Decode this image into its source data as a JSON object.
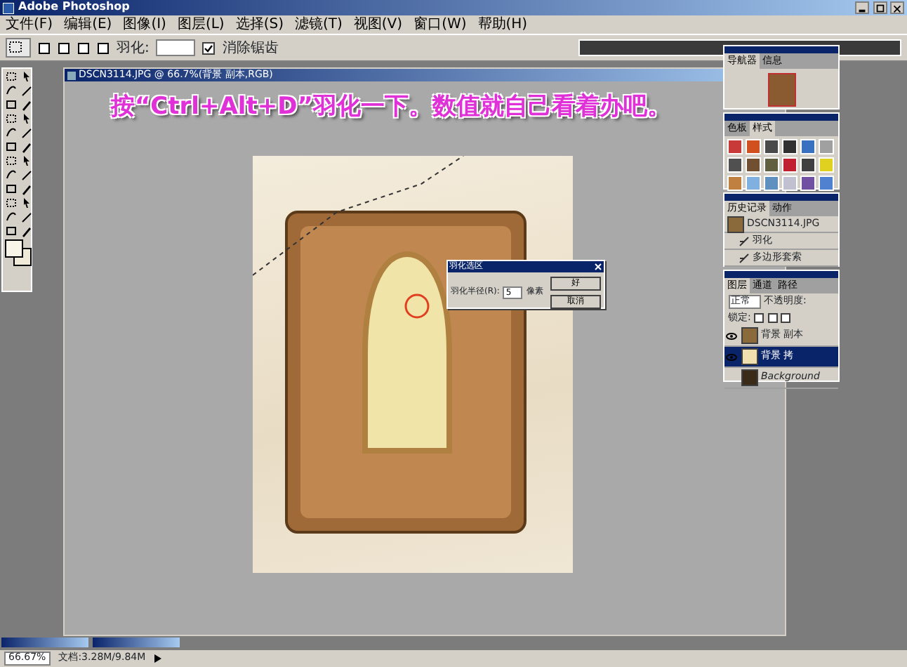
{
  "window": {
    "title": "Adobe Photoshop"
  },
  "menu": [
    "文件(F)",
    "编辑(E)",
    "图像(I)",
    "图层(L)",
    "选择(S)",
    "滤镜(T)",
    "视图(V)",
    "窗口(W)",
    "帮助(H)"
  ],
  "options_bar": {
    "feather_label": "羽化:",
    "anti_alias": {
      "label": "消除锯齿",
      "checked": true
    }
  },
  "document": {
    "title": "DSCN3114.JPG @ 66.7%(背景 副本,RGB)",
    "caption": "按“Ctrl+Alt+D”羽化一下。数值就自己看着办吧。"
  },
  "dialog": {
    "title": "羽化选区",
    "label": "羽化半径(R):",
    "value": "5",
    "unit": "像素",
    "buttons": [
      "好",
      "取消"
    ]
  },
  "navigator": {
    "tabs": [
      {
        "label": "导航器",
        "selected": true
      },
      {
        "label": "信息",
        "selected": false
      }
    ]
  },
  "styles": {
    "tabs": [
      {
        "label": "色板",
        "selected": false
      },
      {
        "label": "样式",
        "selected": true
      }
    ],
    "swatches": [
      {
        "color": "#c83a3a"
      },
      {
        "color": "#d05020"
      },
      {
        "color": "#4a4a4a"
      },
      {
        "color": "#303030"
      },
      {
        "color": "#3a70c0"
      },
      {
        "color": "#a0a0a0"
      },
      {
        "color": "#505050"
      },
      {
        "color": "#705030"
      },
      {
        "color": "#606040"
      },
      {
        "color": "#c02030"
      },
      {
        "color": "#404040"
      },
      {
        "color": "#e0d020"
      },
      {
        "color": "#c08040"
      },
      {
        "color": "#80b0e0"
      },
      {
        "color": "#6090c0"
      },
      {
        "color": "#c0c0d0"
      },
      {
        "color": "#7050a0"
      },
      {
        "color": "#5080d0"
      }
    ]
  },
  "history": {
    "tabs": [
      {
        "label": "历史记录",
        "selected": true
      },
      {
        "label": "动作",
        "selected": false
      }
    ],
    "items": [
      {
        "kind": "snapshot",
        "label": "DSCN3114.JPG"
      },
      {
        "kind": "step",
        "label": "羽化"
      },
      {
        "kind": "step",
        "label": "多边形套索"
      }
    ]
  },
  "layers": {
    "tabs": [
      {
        "label": "图层",
        "selected": true
      },
      {
        "label": "通道",
        "selected": false
      },
      {
        "label": "路径",
        "selected": false
      }
    ],
    "blend_mode": "正常",
    "opacity_label": "不透明度:",
    "lock_label": "锁定:",
    "items": [
      {
        "kind": "layer",
        "name": "背景 副本",
        "visible": true,
        "selected": false
      },
      {
        "kind": "layer",
        "name": "背景 拷",
        "visible": true,
        "selected": true
      },
      {
        "kind": "background",
        "name": "Background",
        "visible": false,
        "selected": false
      }
    ]
  },
  "status_bar": {
    "zoom": "66.67%",
    "doc": "文档:3.28M/9.84M"
  }
}
